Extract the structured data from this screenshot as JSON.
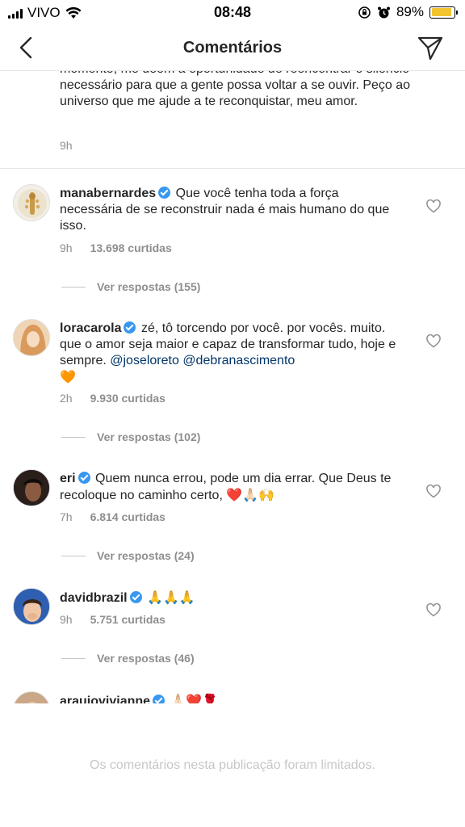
{
  "status": {
    "carrier": "VIVO",
    "time": "08:48",
    "battery": "89%",
    "battery_level": 0.89
  },
  "nav": {
    "title": "Comentários"
  },
  "caption": {
    "text": "momento, me deem a oportunidade de reencontrar o silêncio necessário para que a gente possa voltar a se ouvir. Peço ao universo que me ajude a te reconquistar, meu amor.",
    "time": "9h"
  },
  "comments": [
    {
      "username": "manabernardes",
      "text": "Que você tenha toda a força necessária de se reconstruir nada é mais humano do que isso.",
      "mentions": "",
      "time": "9h",
      "likes": "13.698 curtidas",
      "replies": "Ver respostas (155)"
    },
    {
      "username": "loracarola",
      "text": "zé, tô torcendo por você. por vocês. muito. que o amor seja maior e capaz de transformar tudo, hoje e sempre.",
      "mentions": "@joseloreto @debranascimento",
      "emoji": "🧡",
      "time": "2h",
      "likes": "9.930 curtidas",
      "replies": "Ver respostas (102)"
    },
    {
      "username": "eri",
      "text": "Quem nunca errou, pode um dia errar. Que Deus te recoloque no caminho certo,",
      "mentions": "",
      "emoji": "❤️🙏🏻🙌",
      "time": "7h",
      "likes": "6.814 curtidas",
      "replies": "Ver respostas (24)"
    },
    {
      "username": "davidbrazil",
      "text": "🙏🙏🙏",
      "mentions": "",
      "time": "9h",
      "likes": "5.751 curtidas",
      "replies": "Ver respostas (46)"
    },
    {
      "username": "araujovivianne",
      "text": "🙏🏻❤️🌹"
    }
  ],
  "footer": {
    "limited_text": "Os comentários nesta publicação foram limitados."
  },
  "colors": {
    "accent_verified": "#3897f0",
    "mention": "#003569",
    "muted": "#8e8e8e",
    "battery": "#f4c430"
  }
}
